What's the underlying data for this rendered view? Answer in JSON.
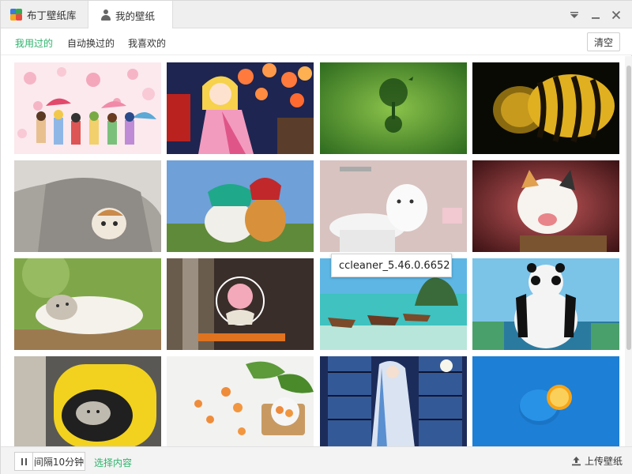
{
  "tabs": {
    "store": "布丁壁纸库",
    "mine": "我的壁纸"
  },
  "subnav": {
    "used": "我用过的",
    "auto": "自动换过的",
    "liked": "我喜欢的",
    "clear": "清空"
  },
  "tooltip": "ccleaner_5.46.0.6652",
  "footer": {
    "interval": "间隔10分钟",
    "select": "选择内容",
    "upload": "上传壁纸"
  },
  "colors": {
    "accent": "#2db36b",
    "logo_blue": "#3a7bd5",
    "logo_green": "#34a853",
    "logo_orange": "#f5a623"
  },
  "icons": {
    "menu": "chevron-down-icon",
    "minimize": "minimize-icon",
    "close": "close-icon",
    "pause": "pause-icon",
    "upload": "upload-icon",
    "user": "user-icon"
  },
  "wallpapers": [
    "anime-kids-umbrellas",
    "anime-girl-lanterns",
    "green-tree-globe",
    "bee-closeup",
    "cat-in-blanket",
    "cats-with-pots",
    "cat-in-sink",
    "laughing-kitten",
    "cat-lying-grass",
    "anime-girl-circle",
    "beach-boats",
    "kung-fu-panda",
    "cat-in-yellow-capsule",
    "fruits-on-table",
    "anime-girl-kimono-night",
    "orange-on-blue"
  ]
}
